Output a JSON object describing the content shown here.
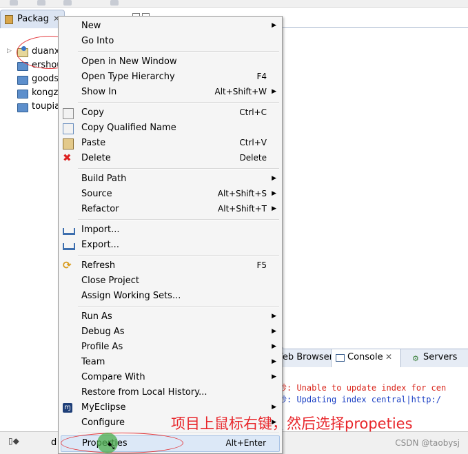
{
  "package_explorer": {
    "tab_label": "Packag",
    "tab_close": "✕",
    "projects": [
      {
        "label": "duanxi"
      },
      {
        "label": "ershou"
      },
      {
        "label": "goods"
      },
      {
        "label": "kongz"
      },
      {
        "label": "toupia"
      }
    ]
  },
  "context_menu": {
    "items": [
      {
        "label": "New",
        "shortcut": "",
        "submenu": true
      },
      {
        "label": "Go Into",
        "shortcut": "",
        "submenu": false
      },
      {
        "label": "Open in New Window",
        "shortcut": "",
        "submenu": false
      },
      {
        "label": "Open Type Hierarchy",
        "shortcut": "F4",
        "submenu": false
      },
      {
        "label": "Show In",
        "shortcut": "Alt+Shift+W",
        "submenu": true
      },
      {
        "label": "Copy",
        "shortcut": "Ctrl+C",
        "submenu": false,
        "icon": "copy-icon"
      },
      {
        "label": "Copy Qualified Name",
        "shortcut": "",
        "submenu": false,
        "icon": "copy-qualified-name-icon"
      },
      {
        "label": "Paste",
        "shortcut": "Ctrl+V",
        "submenu": false,
        "icon": "paste-icon"
      },
      {
        "label": "Delete",
        "shortcut": "Delete",
        "submenu": false,
        "icon": "delete-icon"
      },
      {
        "label": "Build Path",
        "shortcut": "",
        "submenu": true
      },
      {
        "label": "Source",
        "shortcut": "Alt+Shift+S",
        "submenu": true
      },
      {
        "label": "Refactor",
        "shortcut": "Alt+Shift+T",
        "submenu": true
      },
      {
        "label": "Import...",
        "shortcut": "",
        "submenu": false,
        "icon": "import-icon"
      },
      {
        "label": "Export...",
        "shortcut": "",
        "submenu": false,
        "icon": "export-icon"
      },
      {
        "label": "Refresh",
        "shortcut": "F5",
        "submenu": false,
        "icon": "refresh-icon"
      },
      {
        "label": "Close Project",
        "shortcut": "",
        "submenu": false
      },
      {
        "label": "Assign Working Sets...",
        "shortcut": "",
        "submenu": false
      },
      {
        "label": "Run As",
        "shortcut": "",
        "submenu": true
      },
      {
        "label": "Debug As",
        "shortcut": "",
        "submenu": true
      },
      {
        "label": "Profile As",
        "shortcut": "",
        "submenu": true
      },
      {
        "label": "Team",
        "shortcut": "",
        "submenu": true
      },
      {
        "label": "Compare With",
        "shortcut": "",
        "submenu": true
      },
      {
        "label": "Restore from Local History...",
        "shortcut": "",
        "submenu": false
      },
      {
        "label": "MyEclipse",
        "shortcut": "",
        "submenu": true,
        "icon": "myeclipse-icon"
      },
      {
        "label": "Configure",
        "shortcut": "",
        "submenu": true
      },
      {
        "label": "Properties",
        "shortcut": "Alt+Enter",
        "submenu": false,
        "highlighted": true
      }
    ],
    "submenu_arrow": "▶"
  },
  "console": {
    "tabs": [
      {
        "label": "Veb Browser"
      },
      {
        "label": "Console",
        "active": true,
        "close": "✕"
      },
      {
        "label": "Servers"
      }
    ],
    "lines": [
      {
        "text": "秒: Unable to update index for cen",
        "color": "#d9261c"
      },
      {
        "text": "秒: Updating index central|http:/",
        "color": "#1a3fc4"
      }
    ]
  },
  "status_bar": {
    "fragment": "d",
    "watermark": "CSDN @taobysj"
  },
  "annotation": {
    "text": "项目上鼠标右键，然后选择propeties",
    "color": "#e8262b"
  }
}
